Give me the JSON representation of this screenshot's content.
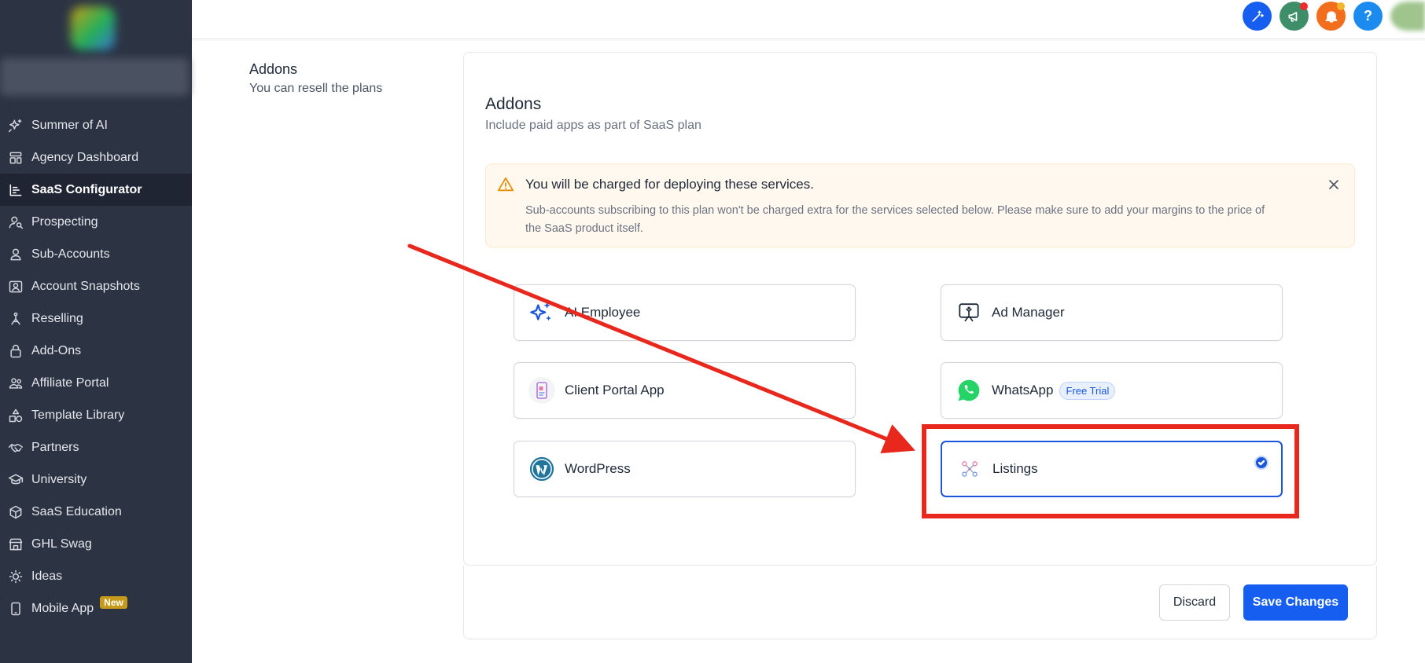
{
  "sidebar": {
    "items": [
      {
        "label": "Summer of AI",
        "icon": "sparkles-icon"
      },
      {
        "label": "Agency Dashboard",
        "icon": "dashboard-icon"
      },
      {
        "label": "SaaS Configurator",
        "icon": "chart-bar-icon",
        "active": true
      },
      {
        "label": "Prospecting",
        "icon": "user-search-icon"
      },
      {
        "label": "Sub-Accounts",
        "icon": "user-icon"
      },
      {
        "label": "Account Snapshots",
        "icon": "snapshot-icon"
      },
      {
        "label": "Reselling",
        "icon": "reselling-icon"
      },
      {
        "label": "Add-Ons",
        "icon": "lock-icon"
      },
      {
        "label": "Affiliate Portal",
        "icon": "users-icon"
      },
      {
        "label": "Template Library",
        "icon": "shapes-icon"
      },
      {
        "label": "Partners",
        "icon": "handshake-icon"
      },
      {
        "label": "University",
        "icon": "graduation-cap-icon"
      },
      {
        "label": "SaaS Education",
        "icon": "cube-icon"
      },
      {
        "label": "GHL Swag",
        "icon": "store-icon"
      },
      {
        "label": "Ideas",
        "icon": "lightbulb-icon"
      },
      {
        "label": "Mobile App",
        "icon": "mobile-icon",
        "badge": "New"
      }
    ]
  },
  "section": {
    "title": "Addons",
    "subtitle": "You can resell the plans"
  },
  "card": {
    "title": "Addons",
    "subtitle": "Include paid apps as part of SaaS plan",
    "alert": {
      "title": "You will be charged for deploying these services.",
      "body": "Sub-accounts subscribing to this plan won't be charged extra for the services selected below. Please make sure to add your margins to the price of the SaaS product itself."
    },
    "addons": [
      {
        "name": "AI Employee",
        "icon": "ai-sparkles-icon"
      },
      {
        "name": "Ad Manager",
        "icon": "ad-manager-icon"
      },
      {
        "name": "Client Portal App",
        "icon": "client-portal-icon"
      },
      {
        "name": "WhatsApp",
        "icon": "whatsapp-icon",
        "badge": "Free Trial"
      },
      {
        "name": "WordPress",
        "icon": "wordpress-icon"
      },
      {
        "name": "Listings",
        "icon": "listings-icon",
        "selected": true
      }
    ]
  },
  "footer": {
    "discard_label": "Discard",
    "save_label": "Save Changes"
  },
  "topbar": {
    "help_label": "?"
  },
  "colors": {
    "sidebar_bg": "#2c3444",
    "primary": "#155eef",
    "annotation_red": "#e8271d",
    "alert_bg": "#fff8ef"
  }
}
